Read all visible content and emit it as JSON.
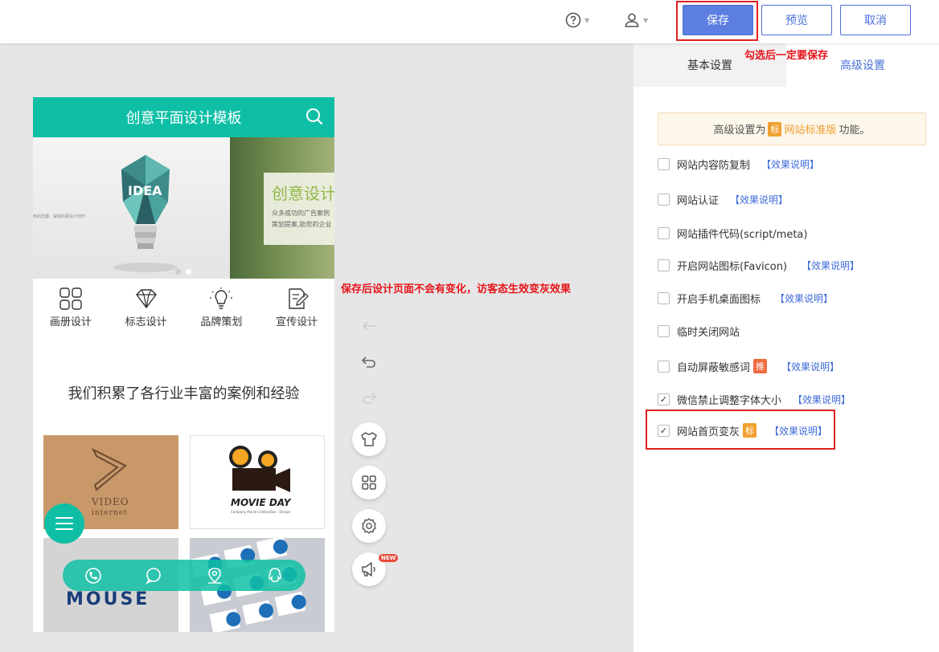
{
  "topbar": {
    "help_icon": "question-circle-icon",
    "user_icon": "user-icon",
    "save_label": "保存",
    "preview_label": "预览",
    "cancel_label": "取消"
  },
  "annotations": {
    "save_note": "勾选后一定要保存",
    "design_note": "保存后设计页面不会有变化，访客态生效变灰效果"
  },
  "panel": {
    "tabs": [
      {
        "label": "基本设置"
      },
      {
        "label": "高级设置"
      }
    ],
    "notice": {
      "prefix": "高级设置为",
      "tag": "标",
      "link": "网站标准版",
      "suffix": "功能。"
    },
    "help_label": "【效果说明】",
    "options": [
      {
        "label": "网站内容防复制",
        "checked": false,
        "help": "【效果说明】"
      },
      {
        "label": "网站认证",
        "checked": false,
        "help": "【效果说明】"
      },
      {
        "label": "网站插件代码(script/meta)",
        "checked": false
      },
      {
        "label": "开启网站图标(Favicon)",
        "checked": false,
        "help": "【效果说明】"
      },
      {
        "label": "开启手机桌面图标",
        "checked": false,
        "help": "【效果说明】"
      },
      {
        "label": "临时关闭网站",
        "checked": false
      },
      {
        "label": "自动屏蔽敏感词",
        "checked": false,
        "badge": "推",
        "help": "【效果说明】"
      },
      {
        "label": "微信禁止调整字体大小",
        "checked": true,
        "help": "【效果说明】"
      },
      {
        "label": "网站首页变灰",
        "checked": true,
        "badge": "标",
        "help": "【效果说明】"
      }
    ],
    "check_mark": "✓"
  },
  "phone": {
    "title": "创意平面设计模板",
    "banner": {
      "headline": "创意设计",
      "line1": "众多成功的广告案例",
      "line2": "策划提案,助您的企业",
      "tiny": "色的志趣、提现的视设计创作"
    },
    "nav": [
      {
        "label": "画册设计",
        "icon": "grid-icon"
      },
      {
        "label": "标志设计",
        "icon": "diamond-icon"
      },
      {
        "label": "品牌策划",
        "icon": "bulb-icon"
      },
      {
        "label": "宣传设计",
        "icon": "edit-icon"
      }
    ],
    "slogan": "我们积累了各行业丰富的案例和经验",
    "cards": {
      "video_title": "VIDEO",
      "video_sub": "internet",
      "movie_title": "MOVIE DAY",
      "movie_sub": "Company Movie Celebration · Design",
      "mouse_title": "MOUSE"
    }
  },
  "toolbar": {
    "new_badge": "NEW"
  }
}
